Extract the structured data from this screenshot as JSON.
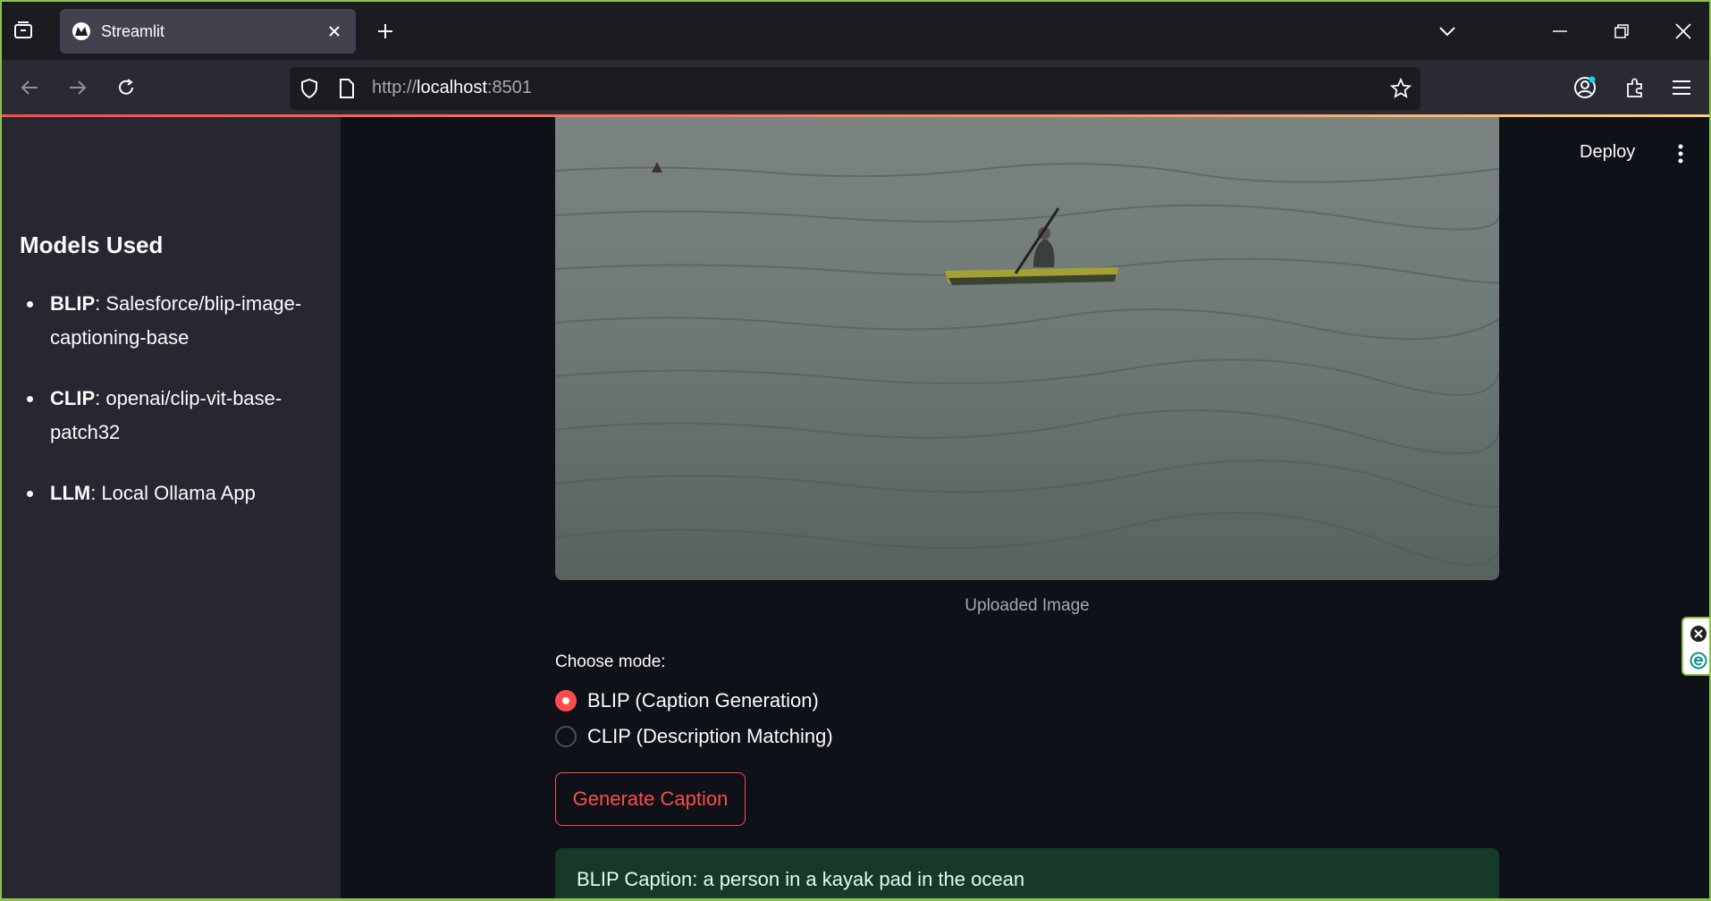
{
  "browser": {
    "tab_title": "Streamlit",
    "url_prefix": "http://",
    "url_host": "localhost",
    "url_port": ":8501"
  },
  "sidebar": {
    "heading": "Models Used",
    "models": [
      {
        "name": "BLIP",
        "value": ": Salesforce/blip-image-captioning-base"
      },
      {
        "name": "CLIP",
        "value": ": openai/clip-vit-base-patch32"
      },
      {
        "name": "LLM",
        "value": ": Local Ollama App"
      }
    ]
  },
  "header": {
    "deploy_label": "Deploy"
  },
  "main": {
    "image_caption": "Uploaded Image",
    "mode_label": "Choose mode:",
    "mode_options": [
      {
        "label": "BLIP (Caption Generation)",
        "selected": true
      },
      {
        "label": "CLIP (Description Matching)",
        "selected": false
      }
    ],
    "generate_label": "Generate Caption",
    "result_text": "BLIP Caption: a person in a kayak pad in the ocean"
  },
  "colors": {
    "accent": "#ff4b4b",
    "sidebar_bg": "#262730",
    "main_bg": "#0e1117",
    "success_bg": "#173928",
    "frame_border": "#8bc34a"
  }
}
